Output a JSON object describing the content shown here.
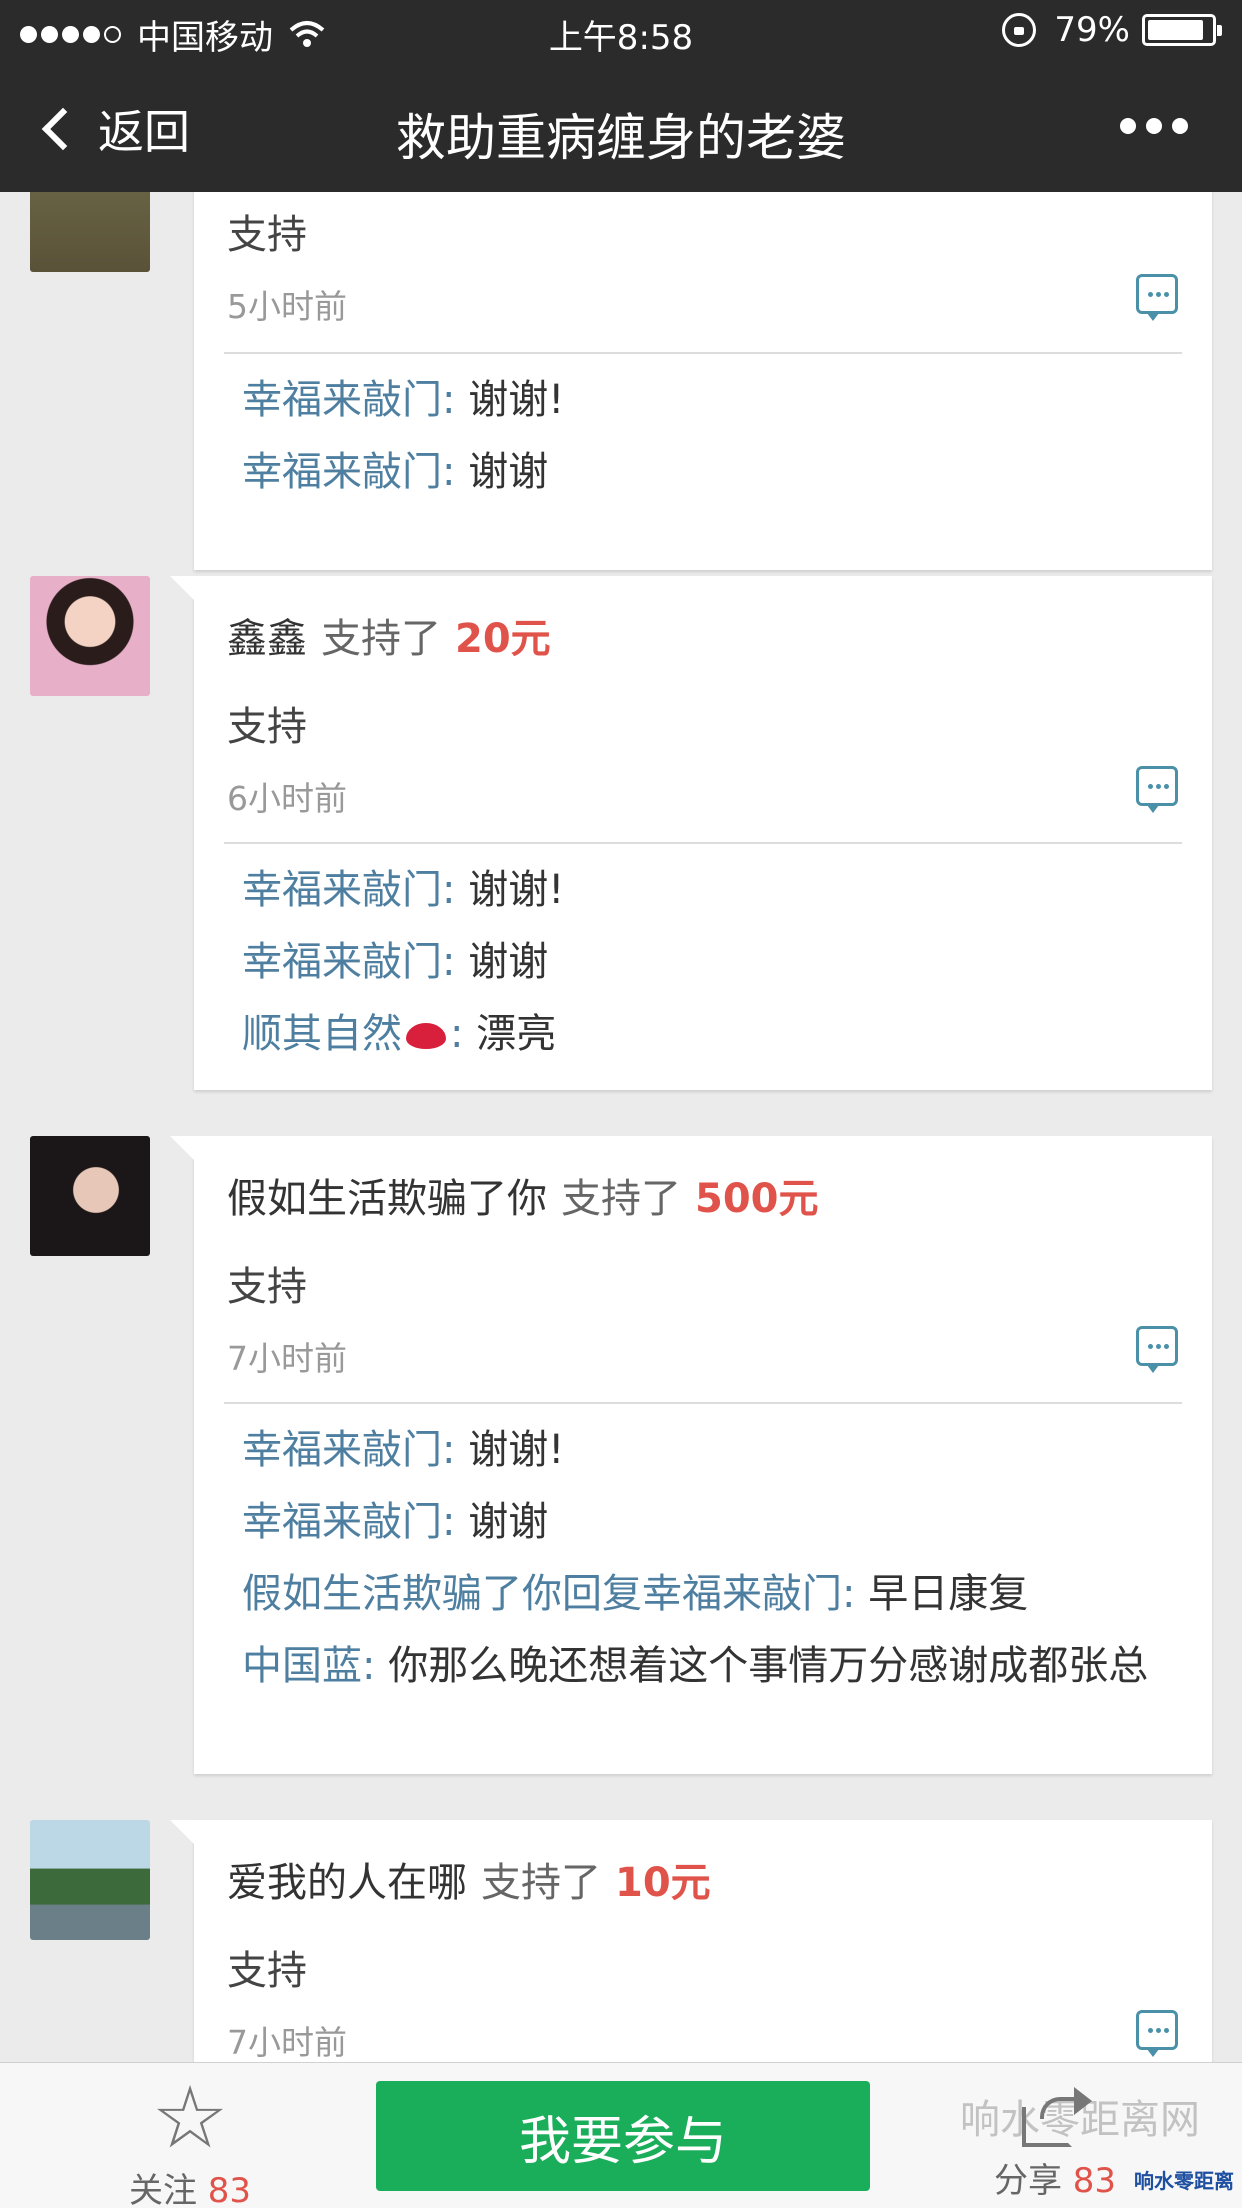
{
  "status_bar": {
    "carrier": "中国移动",
    "time": "上午8:58",
    "battery": "79%",
    "battery_level": 0.79
  },
  "nav": {
    "back_label": "返回",
    "title": "救助重病缠身的老婆"
  },
  "entries": [
    {
      "message": "支持",
      "time": "5小时前",
      "comments": [
        {
          "name": "幸福来敲门:",
          "text": " 谢谢!"
        },
        {
          "name": "幸福来敲门:",
          "text": " 谢谢"
        }
      ]
    },
    {
      "nick": "鑫鑫",
      "verb": "支持了",
      "amount": "20元",
      "message": "支持",
      "time": "6小时前",
      "comments": [
        {
          "name": "幸福来敲门:",
          "text": " 谢谢!"
        },
        {
          "name": "幸福来敲门:",
          "text": " 谢谢"
        },
        {
          "name": "顺其自然",
          "emoji": "lips-emoji",
          "name_suffix": ":",
          "text": " 漂亮"
        }
      ]
    },
    {
      "nick": "假如生活欺骗了你",
      "verb": "支持了",
      "amount": "500元",
      "message": "支持",
      "time": "7小时前",
      "comments": [
        {
          "name": "幸福来敲门:",
          "text": " 谢谢!"
        },
        {
          "name": "幸福来敲门:",
          "text": " 谢谢"
        },
        {
          "name": "假如生活欺骗了你回复幸福来敲门:",
          "text": " 早日康复"
        },
        {
          "name": "中国蓝:",
          "text": " 你那么晚还想着这个事情万分感谢成都张总"
        }
      ]
    },
    {
      "nick": "爱我的人在哪",
      "verb": "支持了",
      "amount": "10元",
      "message": "支持",
      "time": "7小时前"
    }
  ],
  "bottom": {
    "follow_label": "关注",
    "follow_count": "83",
    "join_label": "我要参与",
    "share_label": "分享",
    "share_count": "83",
    "watermark": "响水零距离网",
    "watermark_small": "响水零距离"
  },
  "colors": {
    "accent_green": "#1aad5a",
    "amount_red": "#e0534a",
    "commenter_blue": "#4e7fa0",
    "bar_dark": "#2b2b2b"
  }
}
